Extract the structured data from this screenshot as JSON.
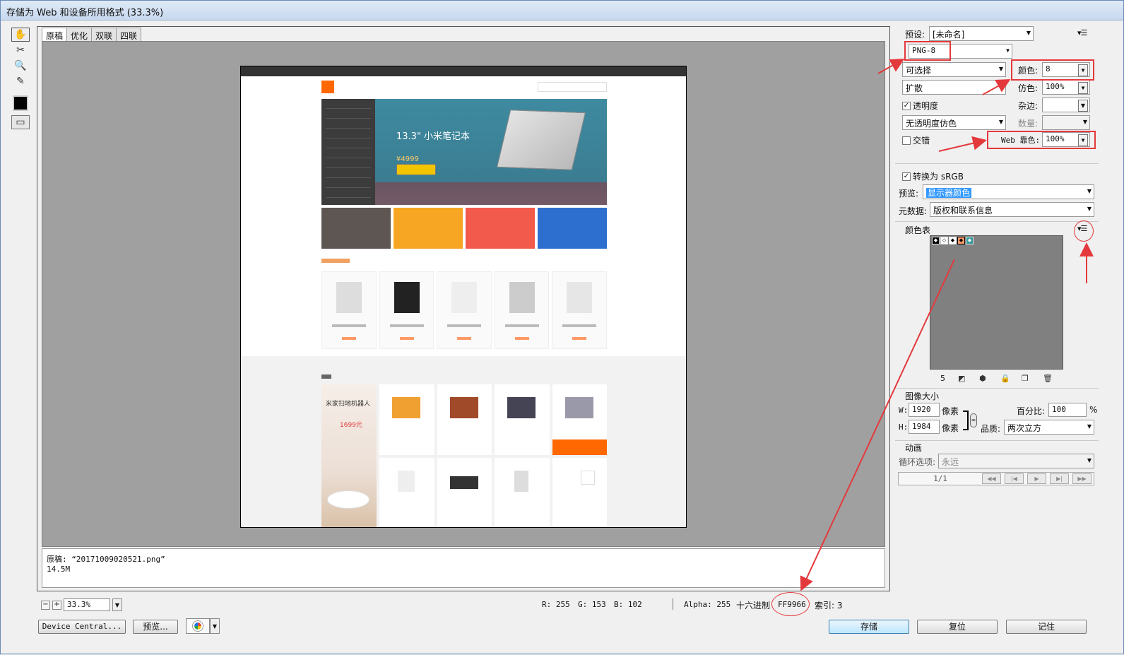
{
  "window": {
    "title": "存储为 Web 和设备所用格式 (33.3%)"
  },
  "tabs": [
    "原稿",
    "优化",
    "双联",
    "四联"
  ],
  "preview_page": {
    "banner_headline": "13.3\" 小米笔记本",
    "banner_price": "¥4999",
    "robot_title": "米家扫地机器人",
    "robot_price": "1699元"
  },
  "info": {
    "line1": "原稿: “20171009020521.png”",
    "line2": "14.5M"
  },
  "status": {
    "zoom": "33.3%",
    "r": "R: 255",
    "g": "G: 153",
    "b": "B: 102",
    "alpha": "Alpha: 255",
    "hex_label": "十六进制",
    "hex": "FF9966",
    "index": "索引: 3"
  },
  "buttons": {
    "device_central": "Device Central...",
    "preview": "预览...",
    "save": "存储",
    "reset": "复位",
    "remember": "记住"
  },
  "settings": {
    "preset_label": "预设:",
    "preset_value": "[未命名]",
    "format": "PNG-8",
    "reduction": "可选择",
    "colors_label": "颜色:",
    "colors_value": "8",
    "dither_algo": "扩散",
    "dither_label": "仿色:",
    "dither_value": "100%",
    "transparency_label": "透明度",
    "matte_label": "杂边:",
    "transparency_dither": "无透明度仿色",
    "amount_label": "数量:",
    "interlaced_label": "交错",
    "web_snap_label": "Web 靠色:",
    "web_snap_value": "100%",
    "convert_srgb_label": "转换为 sRGB",
    "preview_label": "预览:",
    "preview_value": "显示器颜色",
    "metadata_label": "元数据:",
    "metadata_value": "版权和联系信息",
    "color_table_label": "颜色表",
    "color_count": "5"
  },
  "image_size": {
    "title": "图像大小",
    "w_label": "W:",
    "w_value": "1920",
    "h_label": "H:",
    "h_value": "1984",
    "unit": "像素",
    "percent_label": "百分比:",
    "percent_value": "100",
    "percent_sign": "%",
    "quality_label": "品质:",
    "quality_value": "两次立方"
  },
  "animation": {
    "title": "动画",
    "loop_label": "循环选项:",
    "loop_value": "永远",
    "frame_counter": "1/1"
  },
  "colors": {
    "accent_red": "#e4393c",
    "banner_teal": "#3e8aa0",
    "mi_orange": "#ff6700",
    "selection_blue": "#3399ff"
  }
}
